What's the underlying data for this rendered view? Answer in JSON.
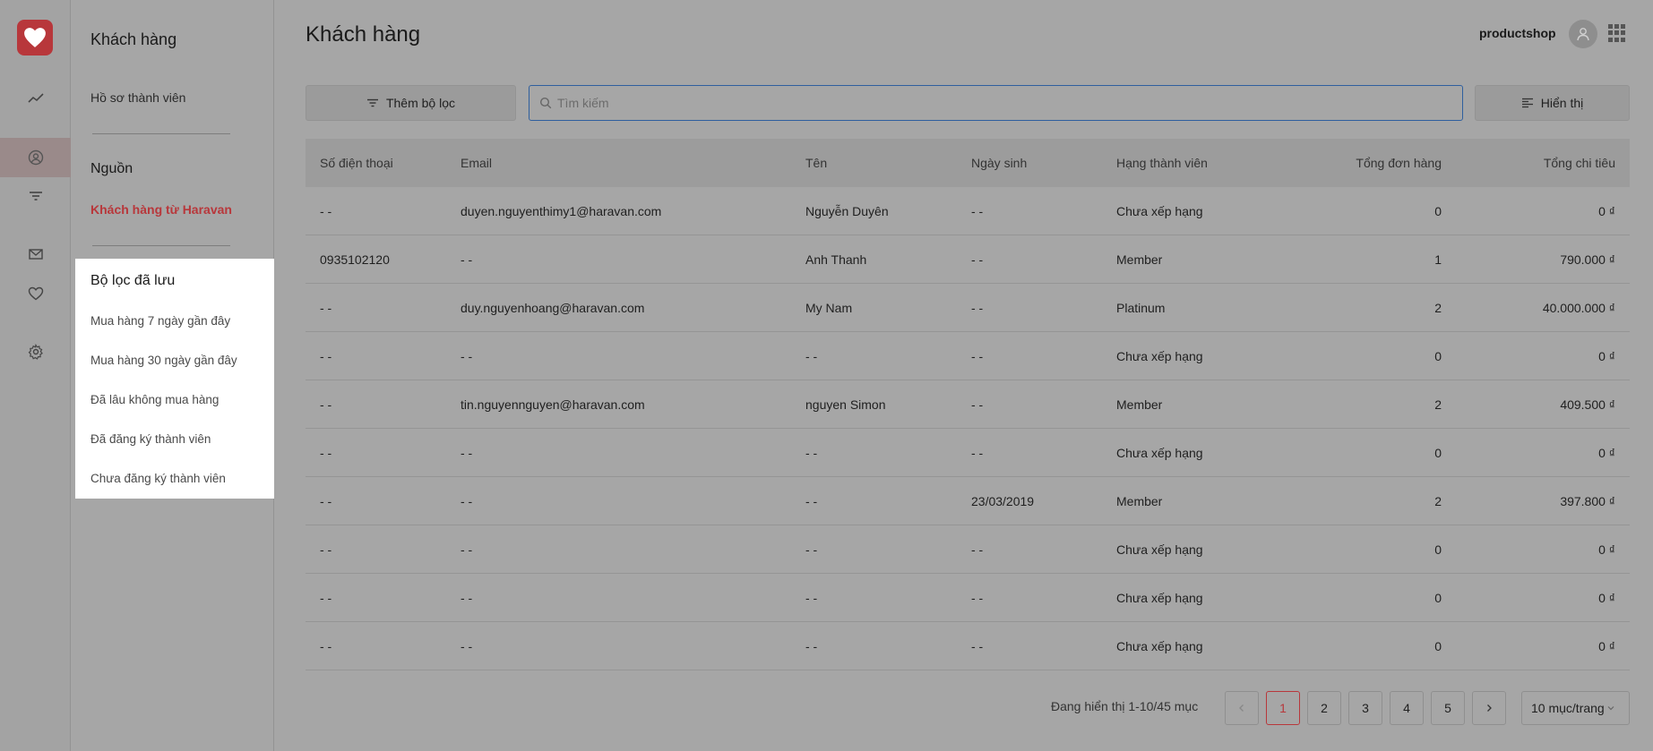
{
  "app": {
    "title": "Khách hàng",
    "shop_name": "productshop",
    "brand_color": "#b8373b"
  },
  "rail": {
    "icons": [
      "heart-logo-icon",
      "chart-line-icon",
      "user-circle-icon",
      "filter-icon",
      "mail-icon",
      "heart-icon",
      "gear-icon"
    ],
    "active": "user-circle-icon"
  },
  "sidebar": {
    "title": "Khách hàng",
    "member_profile": "Hồ sơ thành viên",
    "source_heading": "Nguồn",
    "source_item": "Khách hàng từ Haravan",
    "saved_filters": {
      "title": "Bộ lọc đã lưu",
      "items": [
        "Mua hàng 7 ngày gần đây",
        "Mua hàng 30 ngày gần đây",
        "Đã lâu không mua hàng",
        "Đã đăng ký thành viên",
        "Chưa đăng ký thành viên"
      ]
    }
  },
  "toolbar": {
    "add_filter": "Thêm bộ lọc",
    "search_placeholder": "Tìm kiếm",
    "display": "Hiển thị"
  },
  "table": {
    "headers": [
      "Số điện thoại",
      "Email",
      "Tên",
      "Ngày sinh",
      "Hạng thành viên",
      "Tổng đơn hàng",
      "Tổng chi tiêu"
    ],
    "rows": [
      [
        "- -",
        "duyen.nguyenthimy1@haravan.com",
        "Nguyễn Duyên",
        "- -",
        "Chưa xếp hạng",
        "0",
        "0 ₫"
      ],
      [
        "0935102120",
        "- -",
        "Anh Thanh",
        "- -",
        "Member",
        "1",
        "790.000 ₫"
      ],
      [
        "- -",
        "duy.nguyenhoang@haravan.com",
        "My Nam",
        "- -",
        "Platinum",
        "2",
        "40.000.000 ₫"
      ],
      [
        "- -",
        "- -",
        "- -",
        "- -",
        "Chưa xếp hạng",
        "0",
        "0 ₫"
      ],
      [
        "- -",
        "tin.nguyennguyen@haravan.com",
        "nguyen Simon",
        "- -",
        "Member",
        "2",
        "409.500 ₫"
      ],
      [
        "- -",
        "- -",
        "- -",
        "- -",
        "Chưa xếp hạng",
        "0",
        "0 ₫"
      ],
      [
        "- -",
        "- -",
        "- -",
        "23/03/2019",
        "Member",
        "2",
        "397.800 ₫"
      ],
      [
        "- -",
        "- -",
        "- -",
        "- -",
        "Chưa xếp hạng",
        "0",
        "0 ₫"
      ],
      [
        "- -",
        "- -",
        "- -",
        "- -",
        "Chưa xếp hạng",
        "0",
        "0 ₫"
      ],
      [
        "- -",
        "- -",
        "- -",
        "- -",
        "Chưa xếp hạng",
        "0",
        "0 ₫"
      ]
    ]
  },
  "pagination": {
    "info": "Đang hiển thị 1-10/45 mục",
    "prev": "<",
    "pages": [
      "1",
      "2",
      "3",
      "4",
      "5"
    ],
    "current": "1",
    "next": ">",
    "per_page": "10 mục/trang"
  }
}
